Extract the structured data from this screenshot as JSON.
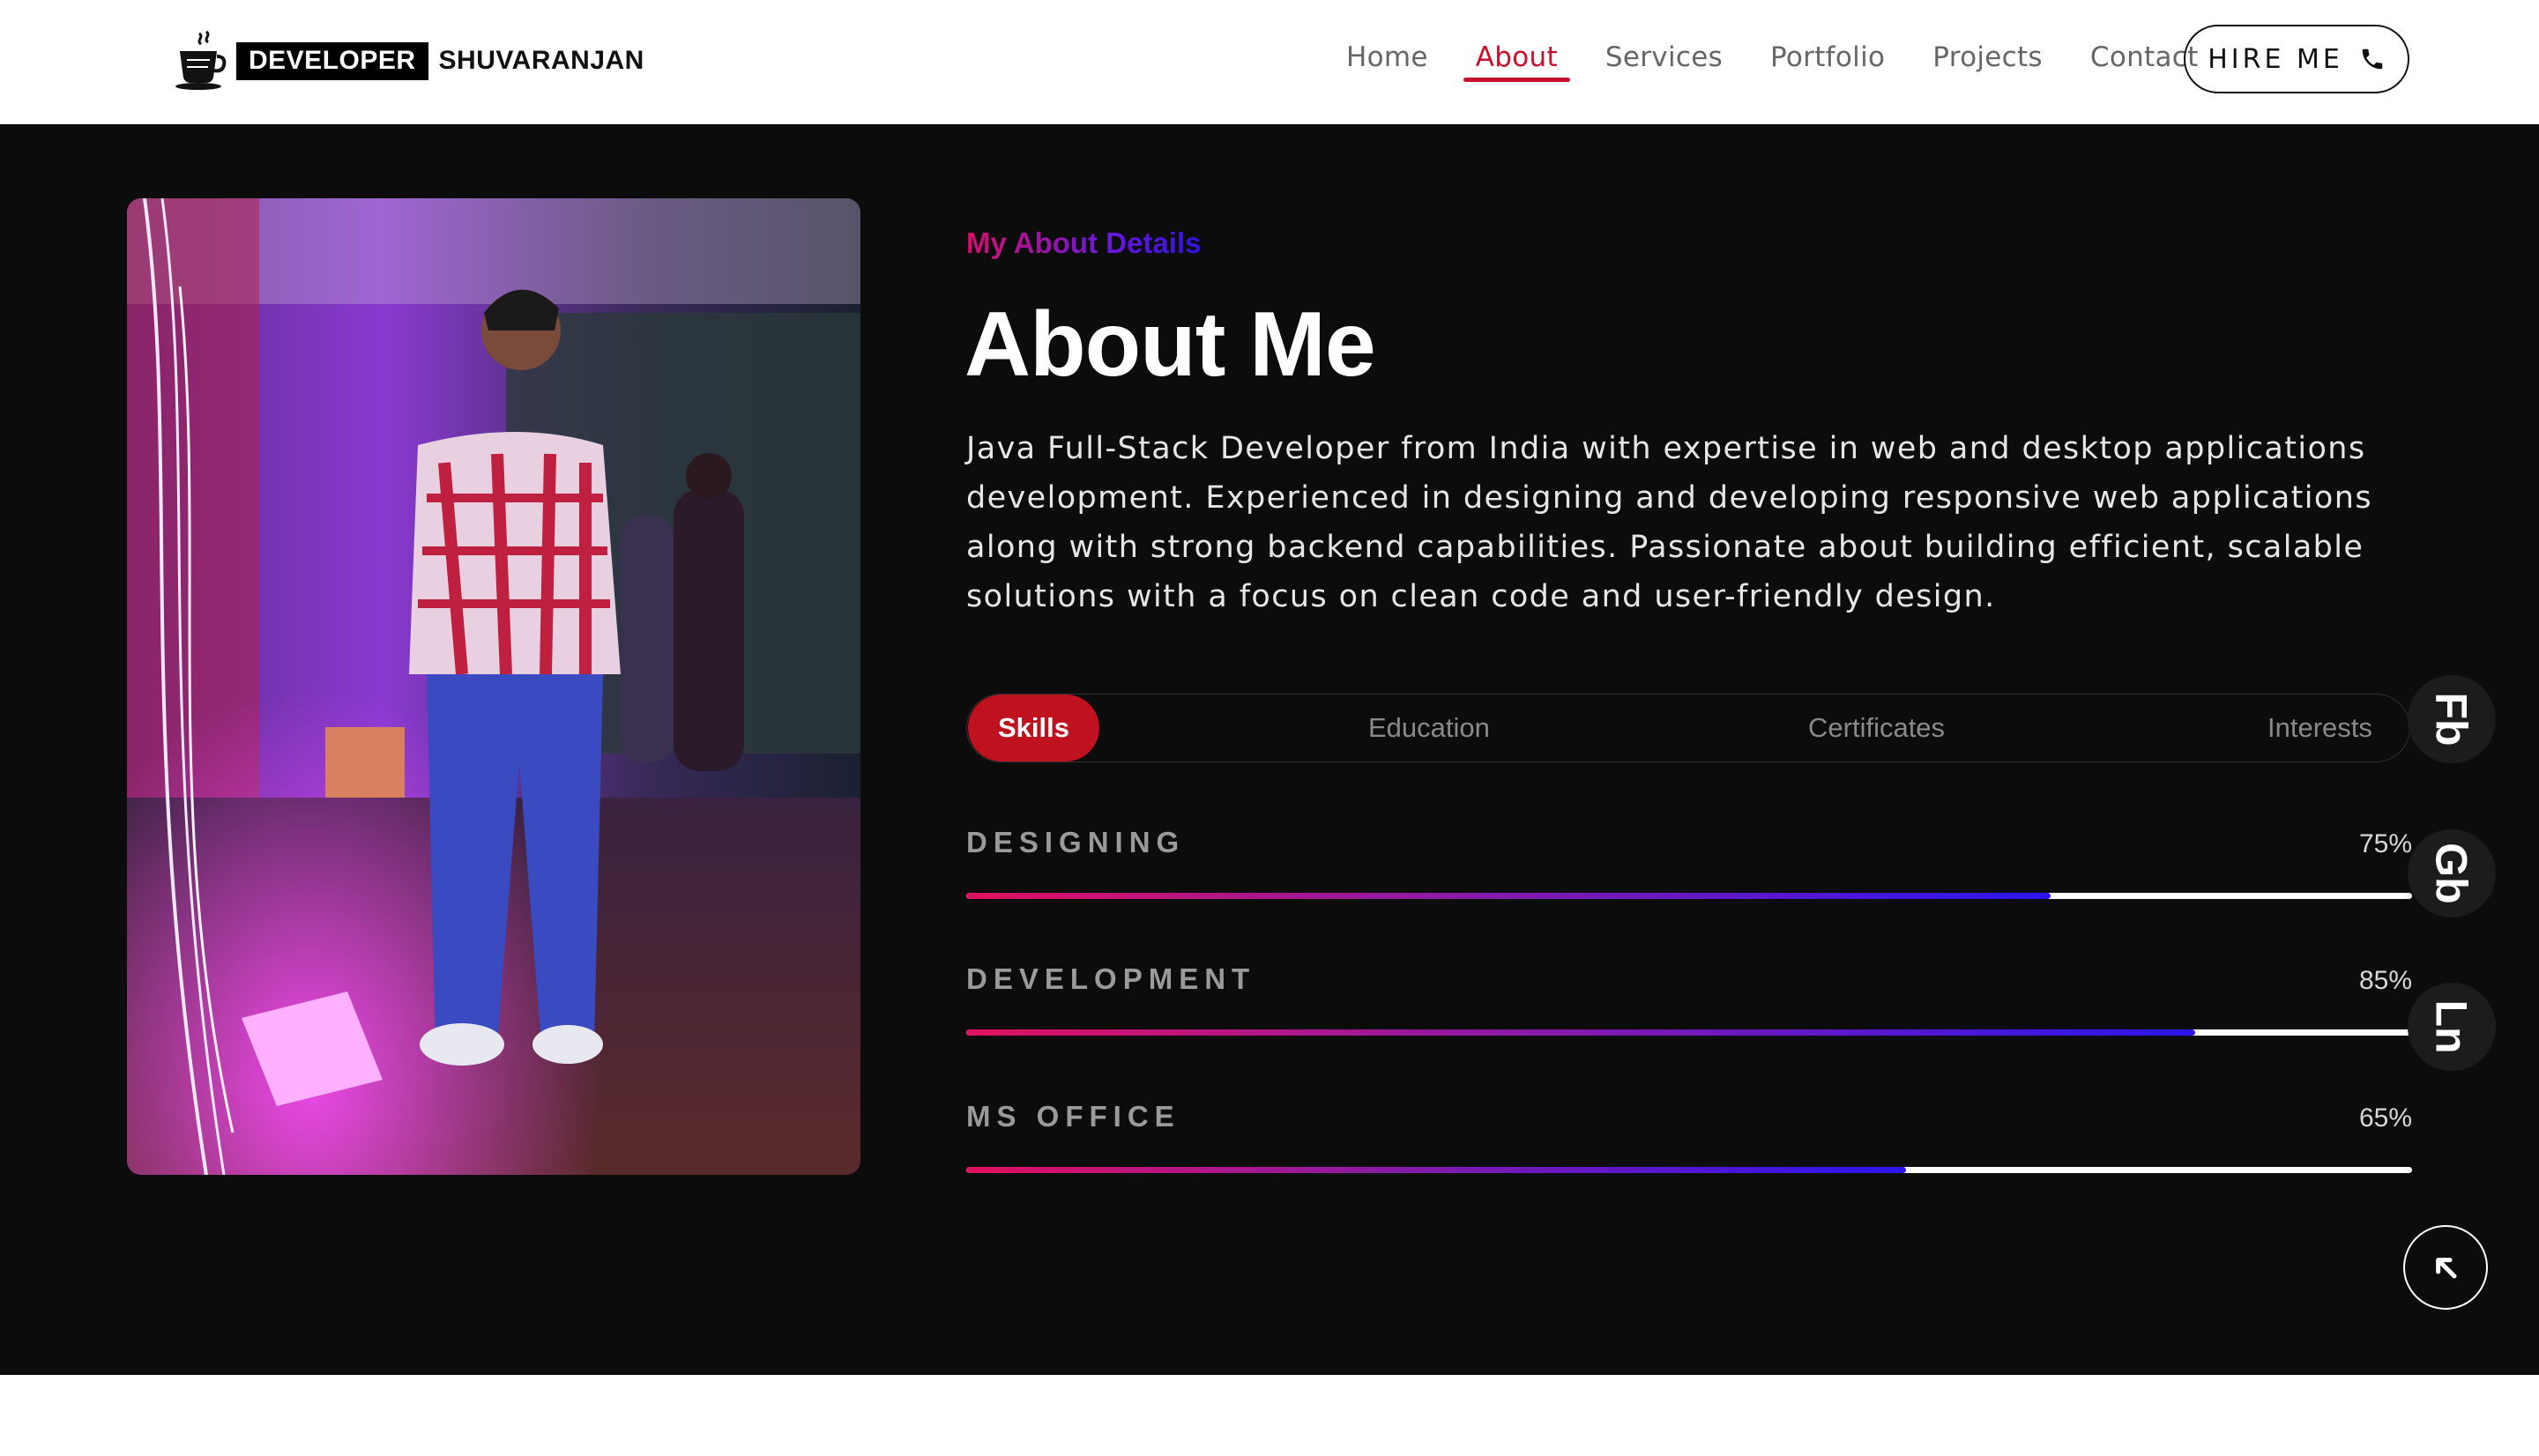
{
  "brand": {
    "badge": "DEVELOPER",
    "name": "SHUVARANJAN"
  },
  "nav": {
    "items": [
      {
        "label": "Home",
        "active": false
      },
      {
        "label": "About",
        "active": true
      },
      {
        "label": "Services",
        "active": false
      },
      {
        "label": "Portfolio",
        "active": false
      },
      {
        "label": "Projects",
        "active": false
      },
      {
        "label": "Contact",
        "active": false
      }
    ],
    "hire_label": "HIRE ME"
  },
  "about": {
    "subtitle": "My About Details",
    "title": "About Me",
    "description": "Java Full-Stack Developer from India with expertise in web and desktop applications development. Experienced in designing and developing responsive web applications along with strong backend capabilities. Passionate about building efficient, scalable solutions with a focus on clean code and user-friendly design."
  },
  "tabs": [
    {
      "label": "Skills",
      "active": true
    },
    {
      "label": "Education",
      "active": false
    },
    {
      "label": "Certificates",
      "active": false
    },
    {
      "label": "Interests",
      "active": false
    }
  ],
  "skills": [
    {
      "name": "DESIGNING",
      "percent_label": "75%",
      "percent": 75
    },
    {
      "name": "DEVELOPMENT",
      "percent_label": "85%",
      "percent": 85
    },
    {
      "name": "MS OFFICE",
      "percent_label": "65%",
      "percent": 65
    }
  ],
  "social": [
    {
      "icon": "facebook-icon",
      "glyph": "Fb"
    },
    {
      "icon": "github-icon",
      "glyph": "Gb"
    },
    {
      "icon": "linkedin-icon",
      "glyph": "Ln"
    }
  ],
  "colors": {
    "accent": "#c8102e",
    "section_bg": "#0c0c0c",
    "gradient_start": "#e0115f",
    "gradient_end": "#2a15ef"
  }
}
